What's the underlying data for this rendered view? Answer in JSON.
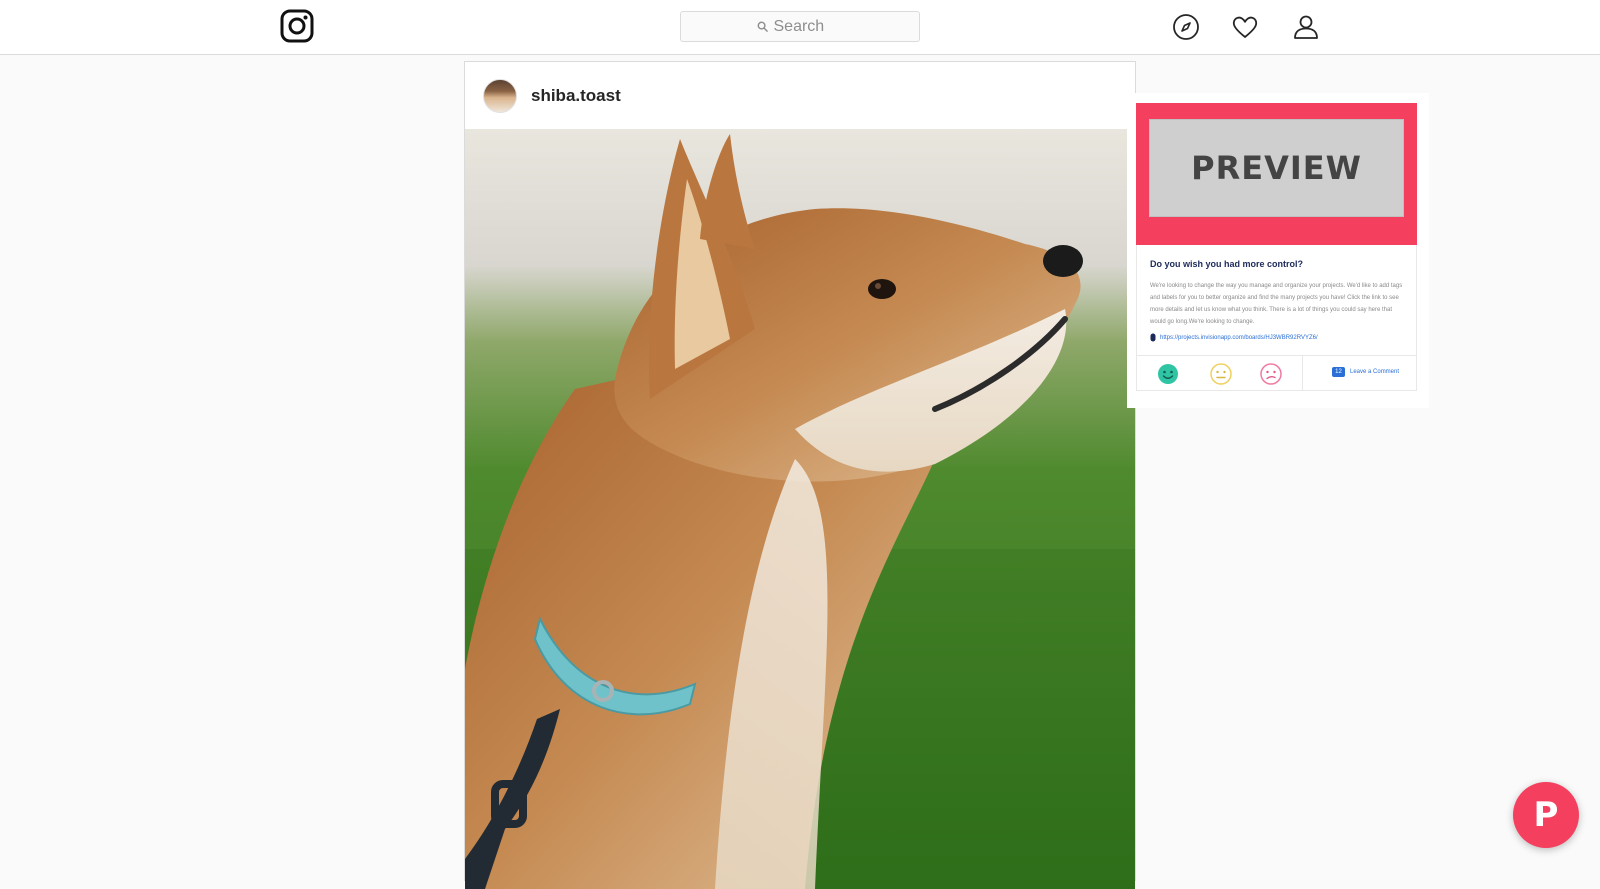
{
  "header": {
    "logo_icon": "instagram-logo-icon",
    "search": {
      "placeholder": "Search"
    },
    "icons": [
      "compass-explore-icon",
      "heart-icon",
      "user-profile-icon"
    ]
  },
  "post": {
    "username": "shiba.toast",
    "image": "Shiba Inu dog in profile wearing a light blue collar, green grass background"
  },
  "preview_widget": {
    "banner_text": "PREVIEW",
    "accent_color": "#f43f5e",
    "title": "Do you wish you had more control?",
    "body": "We're looking to change the way you manage and organize your projects. We'd like to add tags and labels for you to better organize and find the many projects you have! Click the link to see more details and let us know what you think. There is a lot of things you could say here that would go long.We're looking to change.",
    "link": "https://projects.invisionapp.com/boards/HJ3WBR92RVYZ6/",
    "reactions": [
      "happy-face-icon",
      "neutral-face-icon",
      "sad-face-icon"
    ],
    "comment_count": "12",
    "comment_label": "Leave a Comment"
  },
  "fab": {
    "label": "P",
    "color": "#f43f5e"
  }
}
